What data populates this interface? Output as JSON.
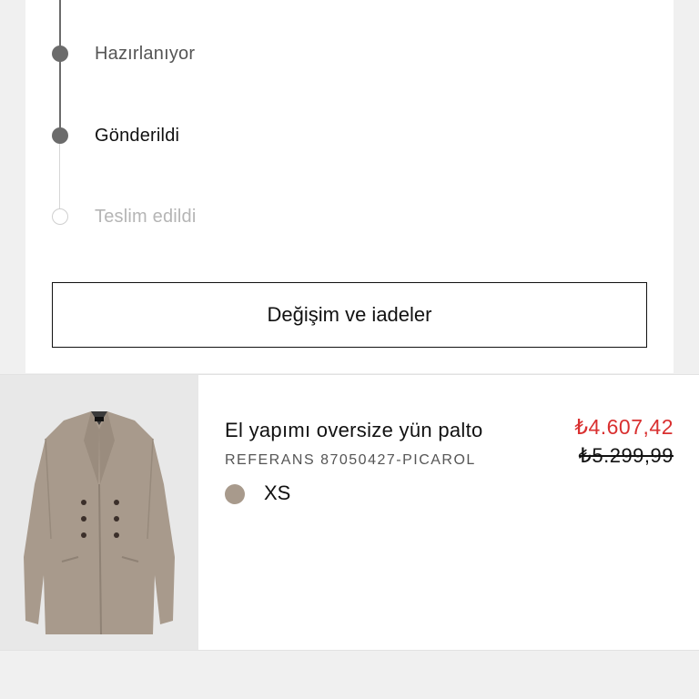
{
  "order_status": {
    "steps": [
      {
        "label": "Hazırlanıyor",
        "state": "done"
      },
      {
        "label": "Gönderildi",
        "state": "current"
      },
      {
        "label": "Teslim edildi",
        "state": "pending"
      }
    ],
    "action_button_label": "Değişim ve iadeler"
  },
  "product": {
    "name": "El yapımı oversize yün palto",
    "reference": "REFERANS 87050427-PICAROL",
    "size": "XS",
    "swatch_color": "#a89a8c",
    "price_sale": "₺4.607,42",
    "price_original": "₺5.299,99",
    "sale_color": "#d93030",
    "image_icon": "coat-image"
  }
}
